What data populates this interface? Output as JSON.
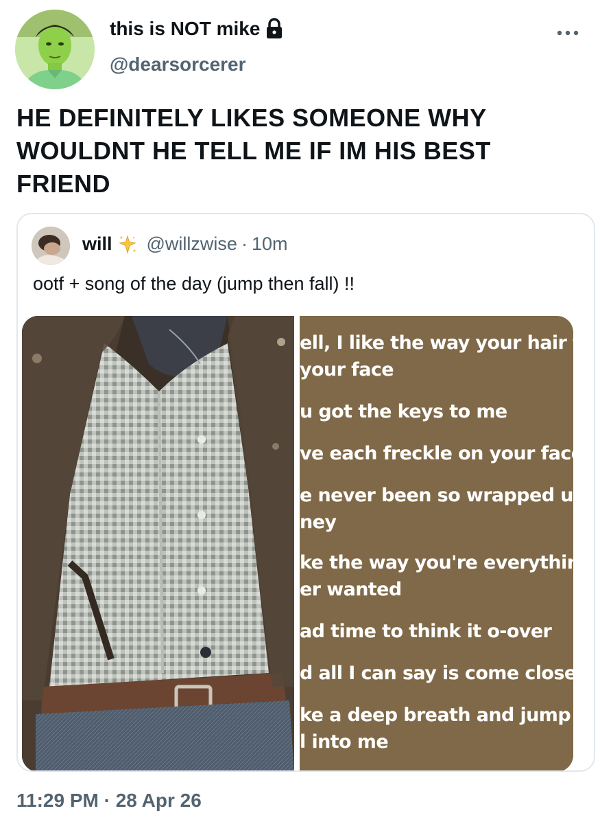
{
  "author": {
    "display_name": "this is NOT mike",
    "handle": "@dearsorcerer",
    "protected_icon": "lock-icon"
  },
  "tweet": {
    "text_lines": [
      "HE DEFINITELY LIKES SOMEONE WHY",
      "WOULDNT HE TELL ME IF IM HIS BEST",
      "FRIEND"
    ],
    "timestamp": "11:29 PM · 28 Apr 26"
  },
  "quote": {
    "name": "will",
    "name_emoji": "sparkle-icon",
    "handle": "@willzwise",
    "separator": "·",
    "time": "10m",
    "text": "ootf + song of the day (jump then fall) !!",
    "lyrics": [
      "ell, I like the way your hair fall",
      "your face",
      "u got the keys to me",
      "ve each freckle on your face,",
      "e never been so wrapped up,",
      "ney",
      "ke the way you're everything",
      "er wanted",
      "ad time to think it o-over",
      "d all I can say is come closer",
      "ke a deep breath and jump th",
      "l into me"
    ]
  },
  "colors": {
    "text": "#0f1419",
    "muted": "#536471",
    "lyrics_bg": "#7f6948"
  }
}
